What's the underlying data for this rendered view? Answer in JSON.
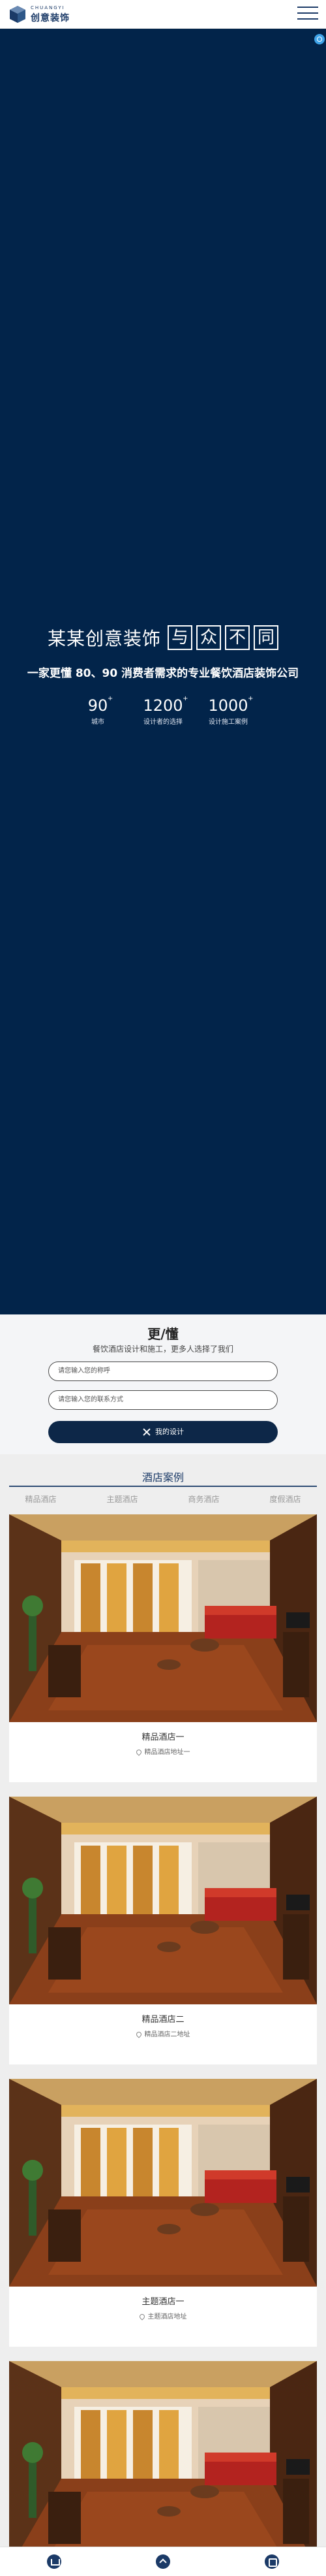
{
  "header": {
    "logo_en": "CHUANGYI",
    "logo_cn": "创意装饰",
    "menu_icon": "hamburger-menu-icon"
  },
  "hero": {
    "title_main": "某某创意装饰",
    "title_boxes": [
      "与",
      "众",
      "不",
      "同"
    ],
    "subtitle": "一家更懂 80、90 消费者需求的专业餐饮酒店装饰公司",
    "stats": [
      {
        "num": "90",
        "sup": "+",
        "label": "城市"
      },
      {
        "num": "1200",
        "sup": "+",
        "label": "设计者的选择"
      },
      {
        "num": "1000",
        "sup": "+",
        "label": "设计施工案例"
      }
    ]
  },
  "form": {
    "title": "更/懂",
    "desc": "餐饮酒店设计和施工，更多人选择了我们",
    "name_placeholder": "请您输入您的称呼",
    "phone_placeholder": "请您输入您的联系方式",
    "submit_label": "我的设计"
  },
  "cases": {
    "title": "酒店案例",
    "tabs": [
      "精品酒店",
      "主题酒店",
      "商务酒店",
      "度假酒店"
    ],
    "items": [
      {
        "name": "精品酒店一",
        "addr": "精品酒店地址一"
      },
      {
        "name": "精品酒店二",
        "addr": "精品酒店二地址"
      },
      {
        "name": "主题酒店一",
        "addr": "主题酒店地址"
      },
      {
        "name": "",
        "addr": ""
      }
    ]
  }
}
